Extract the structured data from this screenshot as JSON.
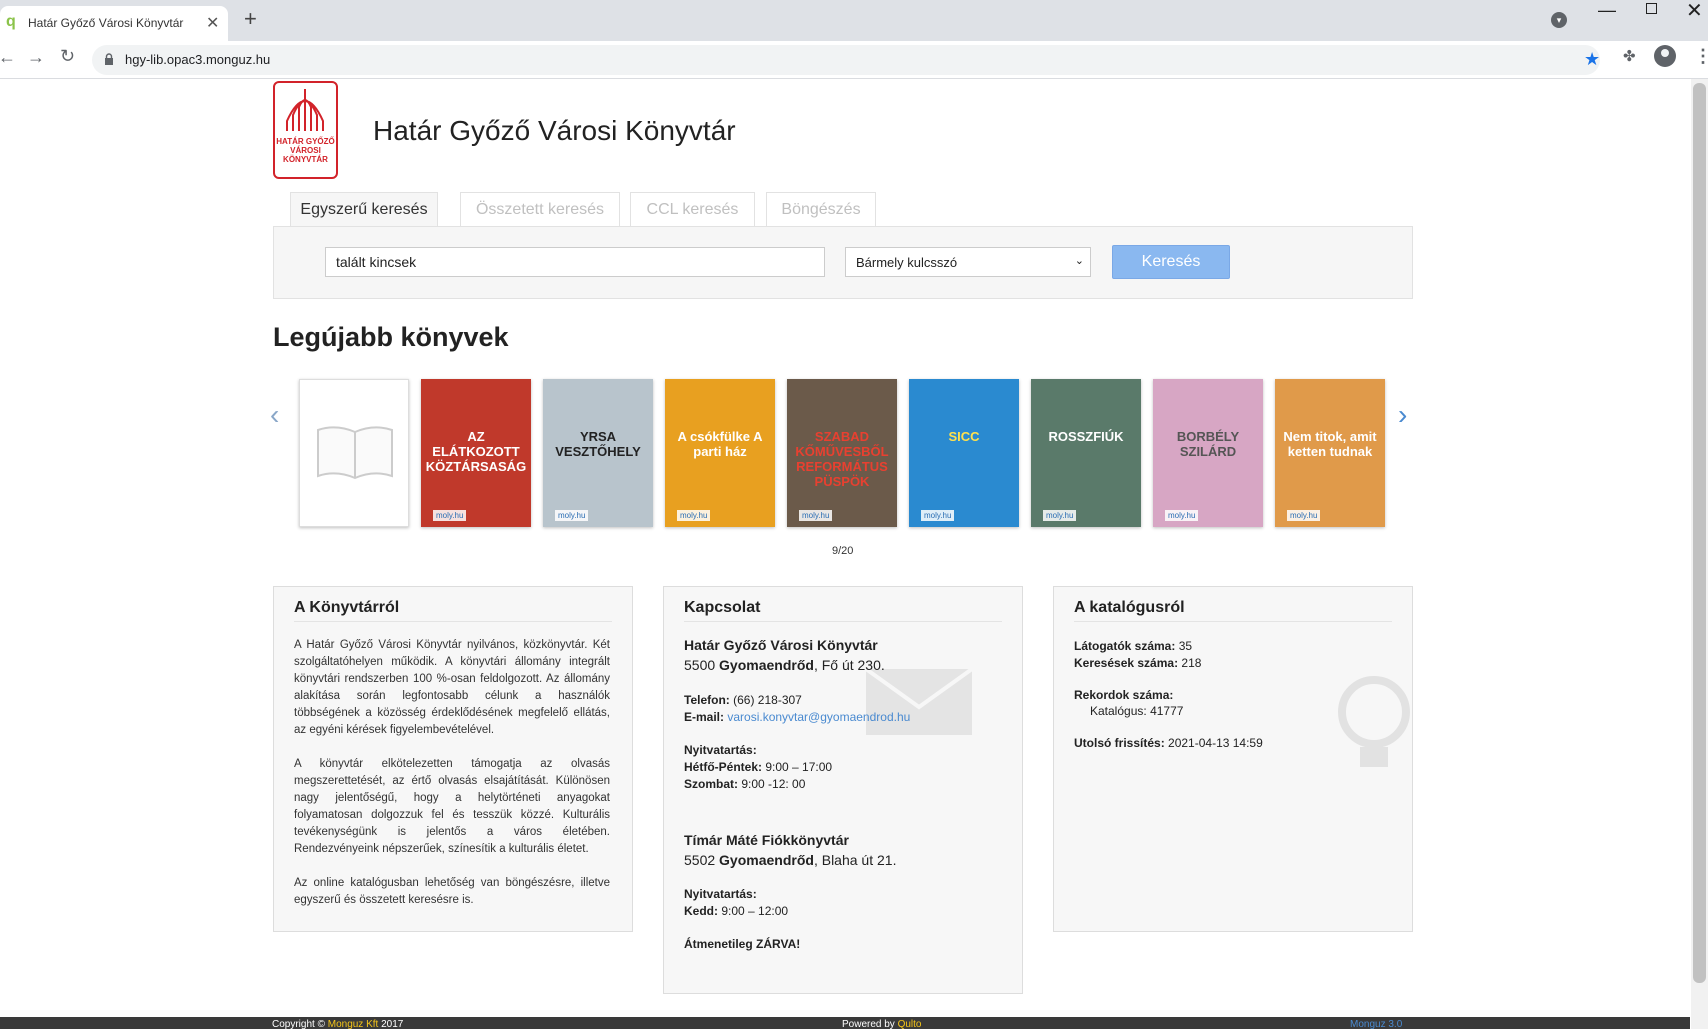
{
  "browser": {
    "tab_title": "Határ Győző Városi Könyvtár",
    "url": "hgy-lib.opac3.monguz.hu"
  },
  "header": {
    "logo_text": "HATÁR GYŐZŐ VÁROSI KÖNYVTÁR",
    "title": "Határ Győző Városi Könyvtár"
  },
  "search": {
    "tabs": [
      "Egyszerű keresés",
      "Összetett keresés",
      "CCL keresés",
      "Böngészés"
    ],
    "active_tab": 0,
    "query": "talált kincsek",
    "field_selected": "Bármely kulcsszó",
    "button_label": "Keresés"
  },
  "newest": {
    "title": "Legújabb könyvek",
    "counter": "9/20",
    "books": [
      {
        "title": "",
        "bg": "#ffffff",
        "fg": "#999999",
        "badge": ""
      },
      {
        "title": "AZ ELÁTKOZOTT KÖZTÁRSASÁG",
        "bg": "#c0392b",
        "fg": "#ffffff",
        "badge": "moly.hu"
      },
      {
        "title": "YRSA VESZTŐHELY",
        "bg": "#b8c4cc",
        "fg": "#222222",
        "badge": "moly.hu"
      },
      {
        "title": "A csókfülke A parti ház",
        "bg": "#e8a020",
        "fg": "#ffffff",
        "badge": "moly.hu"
      },
      {
        "title": "SZABAD KŐMŰVESBŐL REFORMÁTUS PÜSPÖK",
        "bg": "#6b5a4a",
        "fg": "#e84030",
        "badge": "moly.hu"
      },
      {
        "title": "SICC",
        "bg": "#2a8ad0",
        "fg": "#ffe14d",
        "badge": "moly.hu"
      },
      {
        "title": "ROSSZFIÚK",
        "bg": "#5a7a6a",
        "fg": "#ffffff",
        "badge": "moly.hu"
      },
      {
        "title": "BORBÉLY SZILÁRD",
        "bg": "#d7a6c4",
        "fg": "#555555",
        "badge": "moly.hu"
      },
      {
        "title": "Nem titok, amit ketten tudnak",
        "bg": "#e09a4a",
        "fg": "#ffffff",
        "badge": "moly.hu"
      }
    ]
  },
  "about": {
    "title": "A Könyvtárról",
    "paragraphs": [
      "A Határ Győző Városi Könyvtár nyilvános, közkönyvtár. Két szolgáltatóhelyen működik. A könyvtári állomány integrált könyvtári rendszerben 100 %-osan feldolgozott. Az állomány alakítása során legfontosabb célunk a használók többségének a közösség érdeklődésének megfelelő ellátás, az egyéni kérések figyelembevételével.",
      "A könyvtár elkötelezetten támogatja az olvasás megszerettetését, az értő olvasás elsajátítását. Különösen nagy jelentőségű, hogy a helytörténeti anyagokat folyamatosan dolgozzuk fel és tesszük közzé. Kulturális tevékenységünk is jelentős a város életében. Rendezvényeink népszerűek, színesítik a kulturális életet.",
      "Az online katalógusban lehetőség van böngészésre, illetve egyszerű és összetett keresésre is."
    ]
  },
  "contact": {
    "title": "Kapcsolat",
    "main_name": "Határ Győző Városi Könyvtár",
    "main_zip": "5500",
    "main_city": "Gyomaendrőd",
    "main_street": ", Fő út 230.",
    "phone_label": "Telefon:",
    "phone": "(66) 218-307",
    "email_label": "E-mail:",
    "email": "varosi.konyvtar@gyomaendrod.hu",
    "hours_label": "Nyitvatartás:",
    "weekday_label": "Hétfő-Péntek:",
    "weekday_hours": "9:00 – 17:00",
    "saturday_label": "Szombat:",
    "saturday_hours": "9:00 -12: 00",
    "branch_name": "Tímár Máté Fiókkönyvtár",
    "branch_zip": "5502",
    "branch_city": "Gyomaendrőd",
    "branch_street": ", Blaha út 21.",
    "branch_hours_label": "Nyitvatartás:",
    "tuesday_label": "Kedd:",
    "tuesday_hours": "9:00 – 12:00",
    "closed_note": "Átmenetileg ZÁRVA!"
  },
  "catalog": {
    "title": "A katalógusról",
    "visitors_label": "Látogatók száma:",
    "visitors": "35",
    "searches_label": "Keresések száma:",
    "searches": "218",
    "records_label": "Rekordok száma:",
    "catalog_label": "Katalógus:",
    "catalog_count": "41777",
    "updated_label": "Utolsó frissítés:",
    "updated": "2021-04-13 14:59"
  },
  "footer": {
    "copyright_prefix": "Copyright ©",
    "company": "Monguz Kft",
    "year": "2017",
    "powered_prefix": "Powered by",
    "powered_by": "Qulto",
    "version": "Monguz 3.0"
  },
  "colors": {
    "accent_blue": "#4a8ad0",
    "search_button": "#8ab8f0",
    "logo_red": "#d2232a",
    "footer_bg": "#3a3a3a"
  },
  "icons": [
    "favicon-icon",
    "close-icon",
    "plus-icon",
    "back-icon",
    "forward-icon",
    "reload-icon",
    "lock-icon",
    "star-icon",
    "puzzle-icon",
    "account-icon",
    "kebab-menu-icon",
    "chevron-left-icon",
    "chevron-right-icon",
    "open-book-icon"
  ]
}
